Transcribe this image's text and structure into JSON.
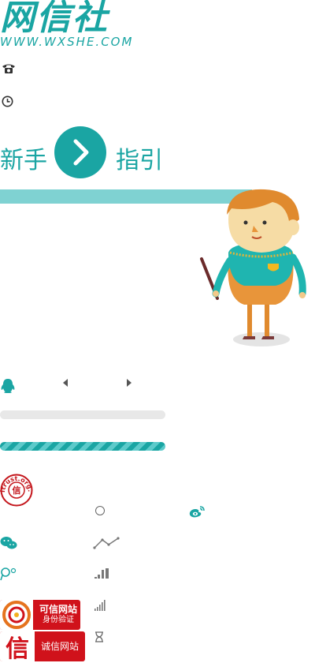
{
  "logo": {
    "main": "网信社",
    "sub": "WWW.WXSHE.COM"
  },
  "contact": {
    "phone_icon": "phone-icon",
    "clock_icon": "clock-icon"
  },
  "guide": {
    "left_text": "新手",
    "right_text": "指引",
    "arrow_icon": "chevron-right-icon"
  },
  "carousel": {
    "qq_icon": "qq-icon",
    "prev_icon": "caret-left-icon",
    "next_icon": "caret-right-icon"
  },
  "trust": {
    "itrust_seal_text": "itrust.org.cn",
    "itrust_seal_char": "信",
    "badge1_title": "可信网站",
    "badge1_sub": "身份验证",
    "badge2_char": "信",
    "badge2_title": "诚信网站"
  },
  "colors": {
    "accent": "#1aa5a3",
    "accent_light": "#7fd2d2",
    "badge_red": "#d0121b"
  }
}
